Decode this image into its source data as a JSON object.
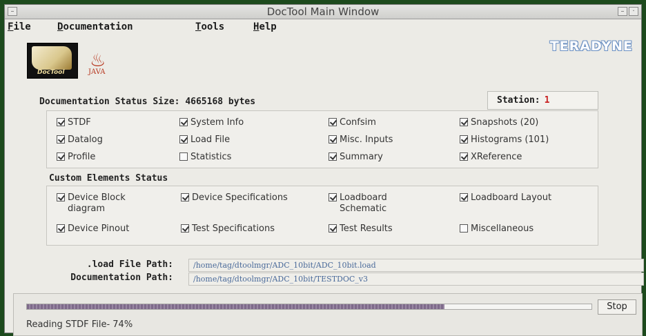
{
  "window": {
    "title": "DocTool Main Window",
    "minimize_glyph": "–",
    "close_glyph": "·"
  },
  "menubar": {
    "items": [
      {
        "mn": "F",
        "rest": "ile"
      },
      {
        "mn": "D",
        "rest": "ocumentation"
      },
      {
        "mn": "T",
        "rest": "ools"
      },
      {
        "mn": "H",
        "rest": "elp"
      }
    ]
  },
  "logos": {
    "doctool_label": "DocTool",
    "java_label": "JAVA",
    "brand": "TERADYNE"
  },
  "doc_status": {
    "title": "Documentation Status Size: 4665168 bytes",
    "station_label": "Station:",
    "station_number": "1",
    "items": [
      {
        "label": "STDF",
        "checked": true
      },
      {
        "label": "System Info",
        "checked": true
      },
      {
        "label": "Confsim",
        "checked": true
      },
      {
        "label": "Snapshots (20)",
        "checked": true
      },
      {
        "label": "Datalog",
        "checked": true
      },
      {
        "label": "Load File",
        "checked": true
      },
      {
        "label": "Misc. Inputs",
        "checked": true
      },
      {
        "label": "Histograms (101)",
        "checked": true
      },
      {
        "label": "Profile",
        "checked": true
      },
      {
        "label": "Statistics",
        "checked": false
      },
      {
        "label": "Summary",
        "checked": true
      },
      {
        "label": "XReference",
        "checked": true
      }
    ]
  },
  "custom_status": {
    "title": "Custom Elements Status",
    "items": [
      {
        "label": "Device Block diagram",
        "checked": true
      },
      {
        "label": "Device Specifications",
        "checked": true
      },
      {
        "label": "Loadboard Schematic",
        "checked": true
      },
      {
        "label": "Loadboard Layout",
        "checked": true
      },
      {
        "label": "Device Pinout",
        "checked": true
      },
      {
        "label": "Test Specifications",
        "checked": true
      },
      {
        "label": "Test Results",
        "checked": true
      },
      {
        "label": "Miscellaneous",
        "checked": false
      }
    ]
  },
  "paths": {
    "load_file_label": ".load File Path:",
    "load_file_value": "/home/tag/dtoolmgr/ADC_10bit/ADC_10bit.load",
    "doc_label": "Documentation Path:",
    "doc_value": "/home/tag/dtoolmgr/ADC_10bit/TESTDOC_v3"
  },
  "status": {
    "progress_percent": 74,
    "stop_label": "Stop",
    "text": "Reading STDF File- 74%"
  }
}
